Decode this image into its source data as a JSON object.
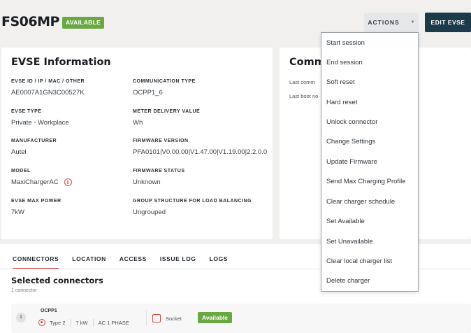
{
  "header": {
    "title": "FS06MP",
    "status_badge": "AVAILABLE",
    "actions_label": "ACTIONS",
    "edit_label": "EDIT EVSE"
  },
  "evse_info": {
    "title": "EVSE Information",
    "fields": [
      {
        "label": "EVSE ID / IP / MAC / OTHER",
        "value": "AE0007A1GN3C00527K"
      },
      {
        "label": "COMMUNICATION TYPE",
        "value": "OCPP1_6"
      },
      {
        "label": "EVSE TYPE",
        "value": "Private - Workplace"
      },
      {
        "label": "METER DELIVERY VALUE",
        "value": "Wh"
      },
      {
        "label": "MANUFACTURER",
        "value": "Autel"
      },
      {
        "label": "FIRMWARE VERSION",
        "value": "PFA0101|V0.00.00|V1.47.00|V1.19.00|2.2.0.0"
      },
      {
        "label": "MODEL",
        "value": "MaxiChargerAC"
      },
      {
        "label": "FIRMWARE STATUS",
        "value": "Unknown"
      },
      {
        "label": "EVSE MAX POWER",
        "value": "7kW"
      },
      {
        "label": "GROUP STRUCTURE FOR LOAD BALANCING",
        "value": "Ungrouped"
      }
    ]
  },
  "communication": {
    "title": "Comm",
    "last_comm": "Last comm",
    "last_boot": "Last boot no"
  },
  "actions_menu": [
    "Start session",
    "End session",
    "Soft reset",
    "Hard reset",
    "Unlock connector",
    "Change Settings",
    "Update Firmware",
    "Send Max Charging Profile",
    "Clear charger schedule",
    "Set Available",
    "Set Unavailable",
    "Clear local charger list",
    "Delete charger"
  ],
  "tabs": [
    "CONNECTORS",
    "LOCATION",
    "ACCESS",
    "ISSUE LOG",
    "LOGS"
  ],
  "connectors": {
    "title": "Selected connectors",
    "count": "1 connector",
    "items": [
      {
        "number": "1",
        "name": "OCPP1",
        "type": "Type 2",
        "power": "7 kW",
        "phase": "AC 1 PHASE",
        "format": "Socket",
        "status": "Available"
      }
    ]
  },
  "colors": {
    "available_green": "#6aa842",
    "edit_button": "#1c3a4a",
    "accent_red": "#d2473f"
  },
  "icons": {
    "info": "info-icon",
    "plug": "type2-plug-icon",
    "socket": "socket-icon"
  }
}
